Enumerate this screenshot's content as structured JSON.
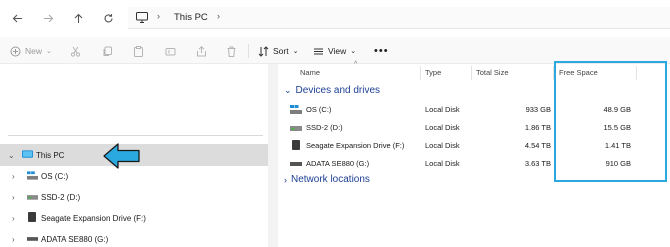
{
  "nav": {
    "back_icon": "arrow-left-icon",
    "forward_icon": "arrow-right-icon",
    "up_icon": "arrow-up-icon",
    "refresh_icon": "refresh-icon"
  },
  "address": {
    "crumb": "This PC"
  },
  "toolbar": {
    "new_label": "New",
    "sort_label": "Sort",
    "view_label": "View"
  },
  "sidebar": {
    "items": [
      {
        "label": "This PC"
      },
      {
        "label": "OS (C:)"
      },
      {
        "label": "SSD-2 (D:)"
      },
      {
        "label": "Seagate Expansion Drive (F:)"
      },
      {
        "label": "ADATA SE880 (G:)"
      }
    ]
  },
  "columns": {
    "name": "Name",
    "type": "Type",
    "total": "Total Size",
    "free": "Free Space"
  },
  "groups": {
    "devices": "Devices and drives",
    "network": "Network locations"
  },
  "drives": [
    {
      "name": "OS (C:)",
      "type": "Local Disk",
      "total": "933 GB",
      "free": "48.9 GB"
    },
    {
      "name": "SSD-2 (D:)",
      "type": "Local Disk",
      "total": "1.86 TB",
      "free": "15.5 GB"
    },
    {
      "name": "Seagate Expansion Drive (F:)",
      "type": "Local Disk",
      "total": "4.54 TB",
      "free": "1.41 TB"
    },
    {
      "name": "ADATA SE880 (G:)",
      "type": "Local Disk",
      "total": "3.63 TB",
      "free": "910 GB"
    }
  ],
  "colors": {
    "highlight": "#29a9e0",
    "group_text": "#1c3f94"
  }
}
